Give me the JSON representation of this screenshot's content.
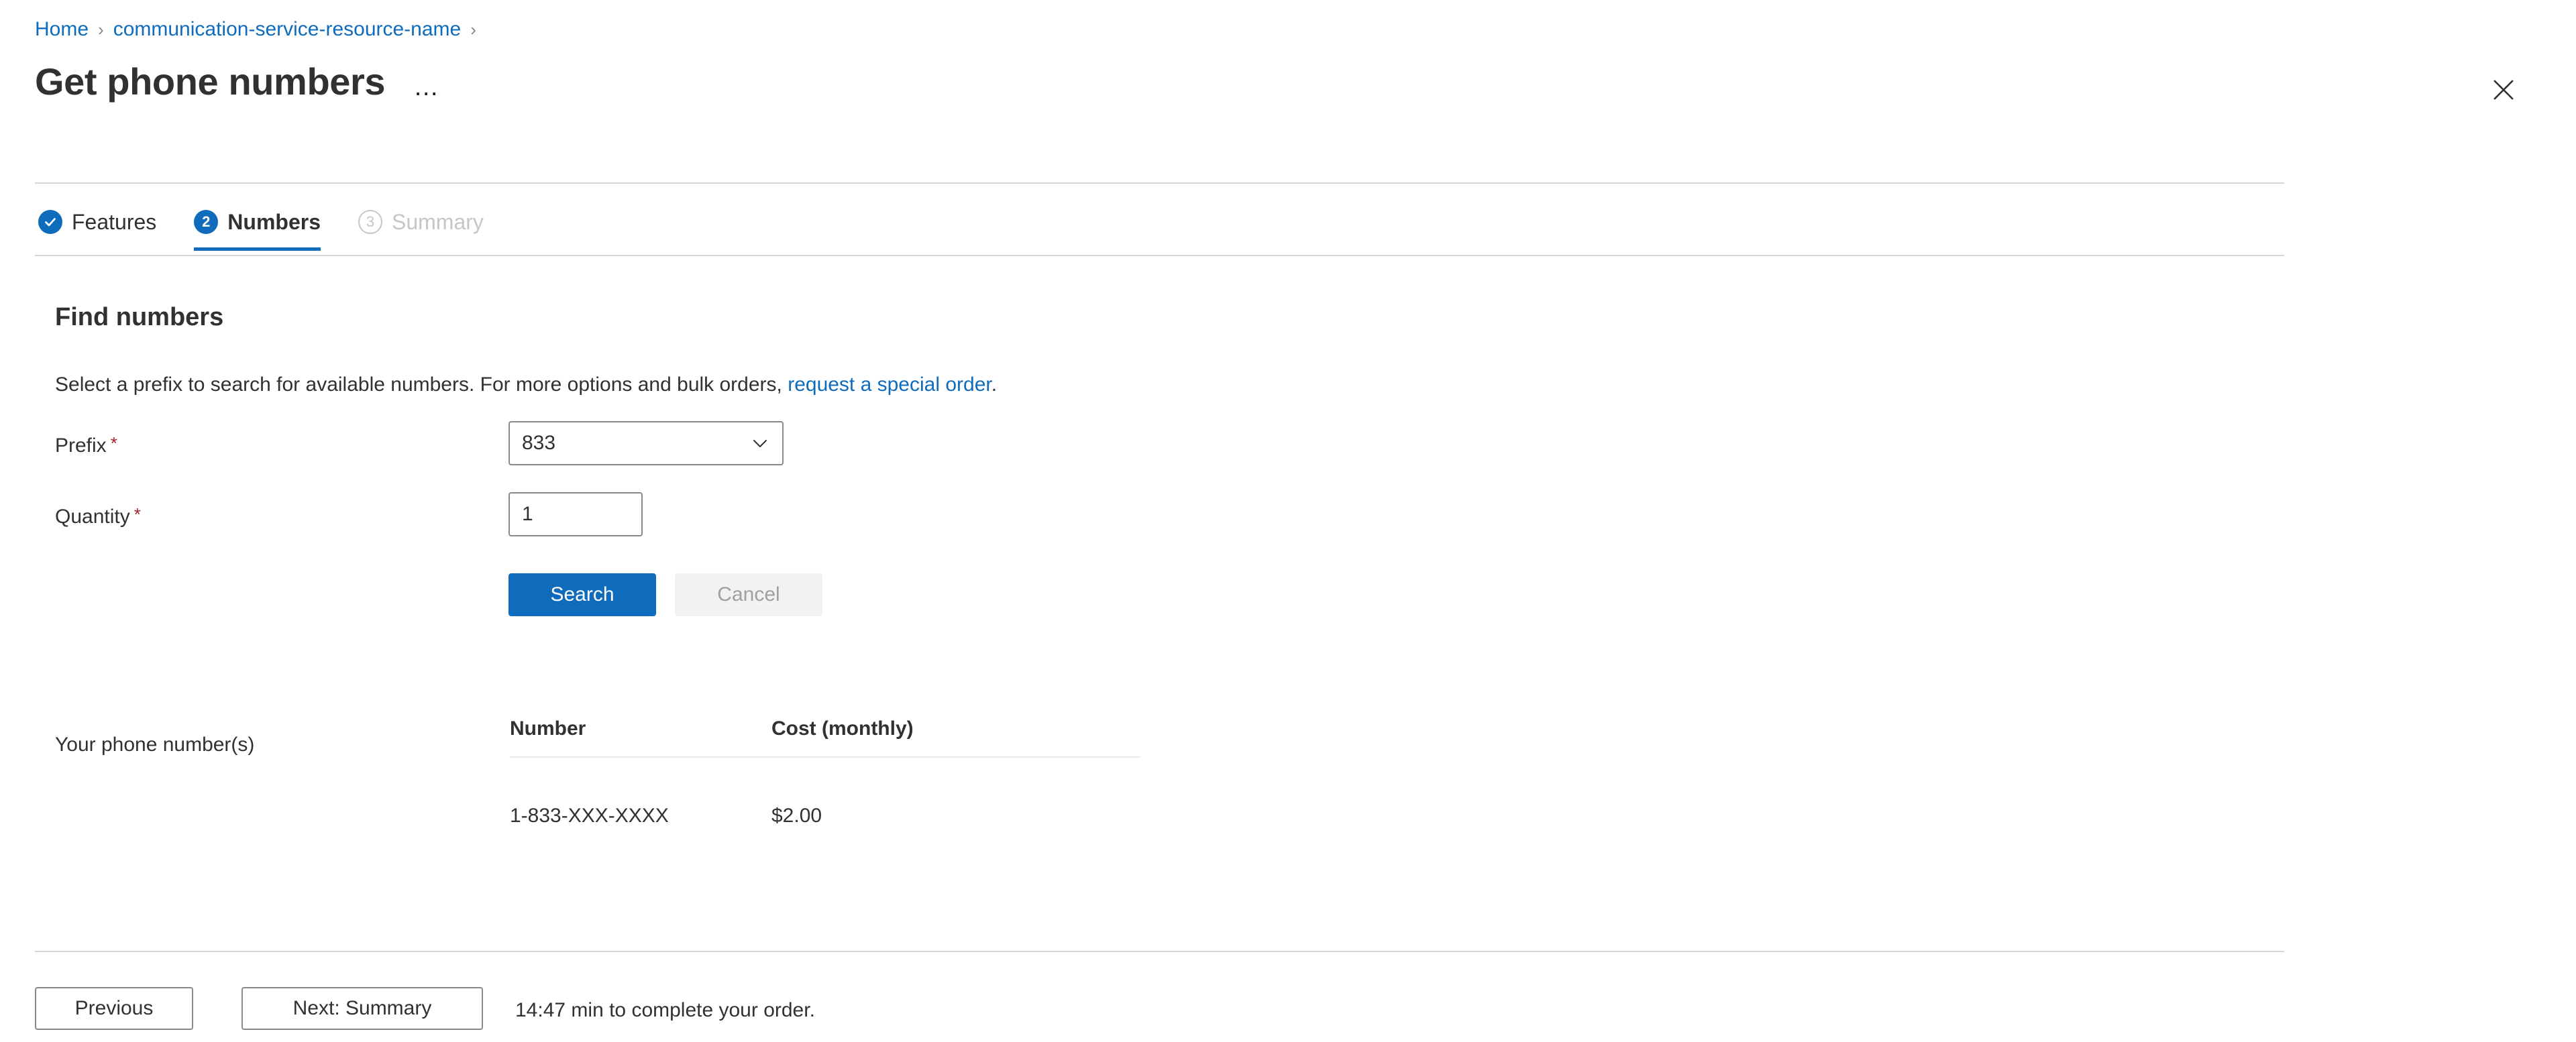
{
  "breadcrumb": {
    "items": [
      {
        "label": "Home"
      },
      {
        "label": "communication-service-resource-name"
      }
    ],
    "separator": "›"
  },
  "header": {
    "title": "Get phone numbers",
    "ellipsis_menu": "…",
    "close_icon": "close-icon"
  },
  "tabs": [
    {
      "label": "Features",
      "badge": "✓",
      "state": "completed"
    },
    {
      "label": "Numbers",
      "badge": "2",
      "state": "active"
    },
    {
      "label": "Summary",
      "badge": "3",
      "state": "disabled"
    }
  ],
  "find_numbers": {
    "heading": "Find numbers",
    "description_before": "Select a prefix to search for available numbers. For more options and bulk orders, ",
    "description_link": "request a special order",
    "description_after": "."
  },
  "form": {
    "prefix": {
      "label": "Prefix",
      "required_marker": "*",
      "value": "833",
      "chevron_icon": "chevron-down-icon"
    },
    "quantity": {
      "label": "Quantity",
      "required_marker": "*",
      "value": "1",
      "placeholder": ""
    },
    "search_label": "Search",
    "cancel_label": "Cancel"
  },
  "results": {
    "label": "Your phone number(s)",
    "columns": [
      "Number",
      "Cost (monthly)"
    ],
    "rows": [
      {
        "number": "1-833-XXX-XXXX",
        "cost": "$2.00"
      }
    ]
  },
  "footer": {
    "previous_label": "Previous",
    "next_label": "Next: Summary",
    "timer_note": "14:47 min to complete your order."
  },
  "colors": {
    "accent": "#0f6cbd",
    "required": "#a4262c",
    "text": "#323130",
    "disabled_text": "#c8c6c4",
    "rule": "#d6d6d6"
  }
}
